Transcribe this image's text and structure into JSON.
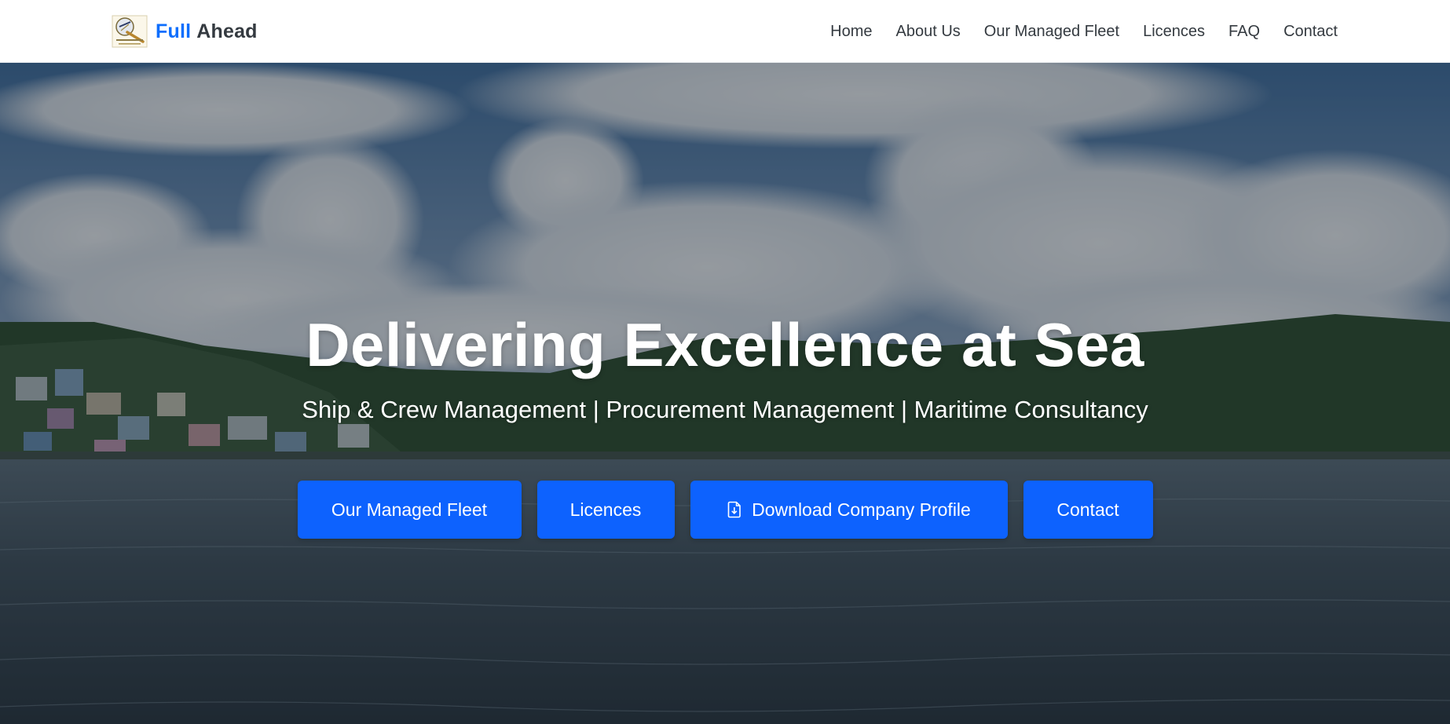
{
  "brand": {
    "name_accent": "Full",
    "name_rest": "Ahead",
    "logo_icon": "compass-logo",
    "accent_color": "#0d6efd"
  },
  "nav": {
    "items": [
      {
        "label": "Home"
      },
      {
        "label": "About Us"
      },
      {
        "label": "Our Managed Fleet"
      },
      {
        "label": "Licences"
      },
      {
        "label": "FAQ"
      },
      {
        "label": "Contact"
      }
    ]
  },
  "hero": {
    "title": "Delivering Excellence at Sea",
    "subtitle": "Ship & Crew Management | Procurement Management | Maritime Consultancy",
    "background": "harbour-sea-clouds-photo",
    "buttons": {
      "fleet": "Our Managed Fleet",
      "licences": "Licences",
      "download": "Download Company Profile",
      "download_icon": "file-download-icon",
      "contact": "Contact"
    },
    "button_color": "#0d62fe"
  }
}
